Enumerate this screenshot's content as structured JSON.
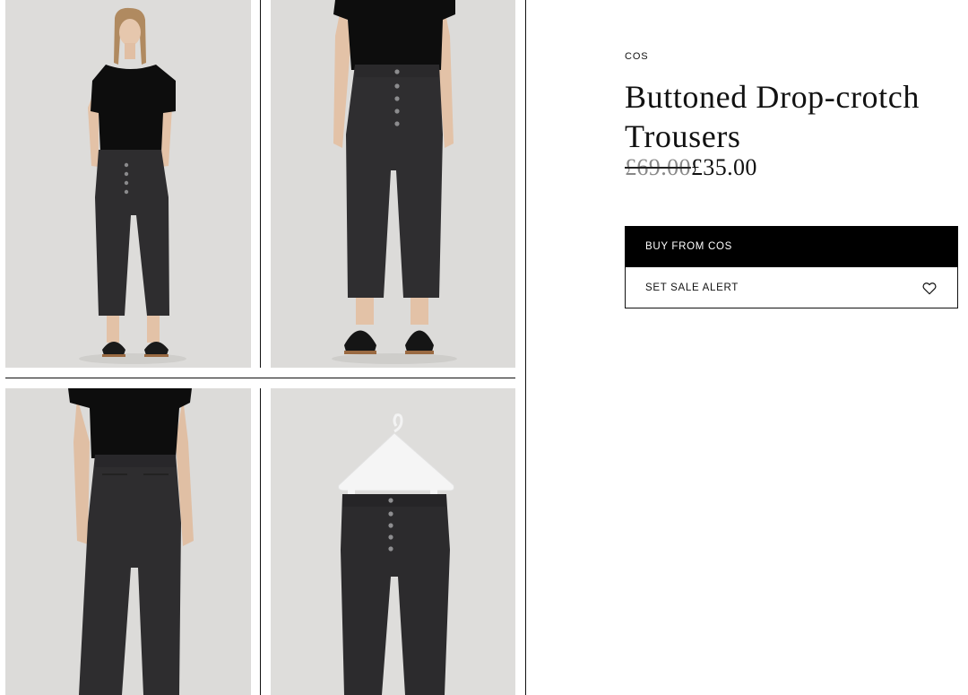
{
  "product": {
    "brand": "COS",
    "title": "Buttoned Drop-crotch Trousers",
    "price_original": "£69.00",
    "price_sale": "£35.00"
  },
  "actions": {
    "buy_label": "BUY FROM COS",
    "alert_label": "SET SALE ALERT",
    "alert_icon": "heart-icon"
  },
  "gallery": {
    "images": [
      {
        "view": "model-front-full"
      },
      {
        "view": "model-front-close"
      },
      {
        "view": "model-back"
      },
      {
        "view": "trousers-on-hanger"
      }
    ]
  },
  "colors": {
    "buy_background": "#000000",
    "photo_background": "#dcdbd9",
    "garment": "#2e2d2e"
  }
}
